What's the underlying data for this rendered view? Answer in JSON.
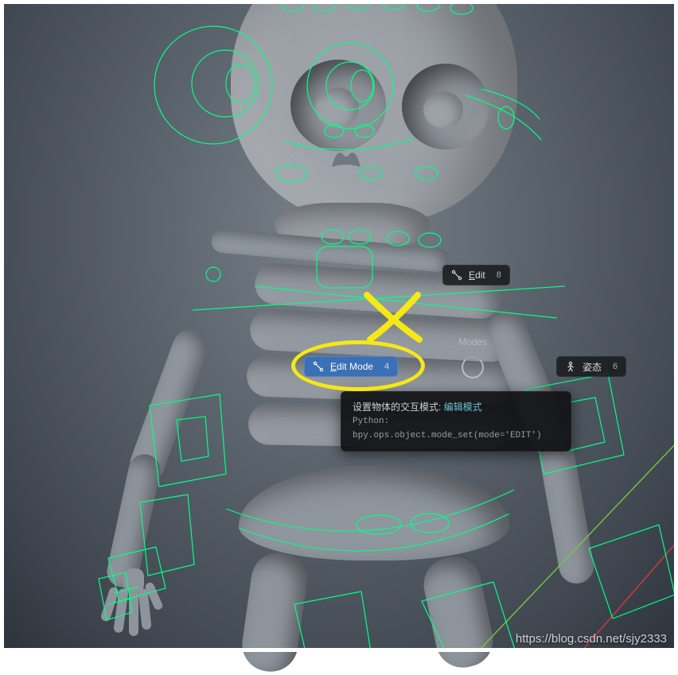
{
  "pie_menu": {
    "header": "Modes",
    "edit_top": {
      "label": "Edit",
      "shortcut": "8"
    },
    "edit_mode": {
      "label": "Edit Mode",
      "shortcut": "4"
    },
    "pose": {
      "label": "姿态",
      "shortcut": "6"
    }
  },
  "tooltip": {
    "line1_prefix": "设置物体的交互模式: ",
    "line1_highlight": "编辑模式",
    "python_prefix": "Python: ",
    "python_code": "bpy.ops.object.mode_set(mode='EDIT')"
  },
  "watermark": "https://blog.csdn.net/sjy2333"
}
